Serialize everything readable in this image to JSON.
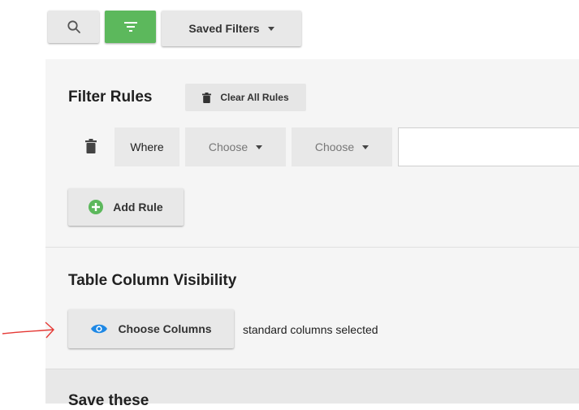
{
  "toolbar": {
    "search_icon": "search-icon",
    "filter_icon": "filter-icon",
    "saved_filters_label": "Saved Filters",
    "filter_active_color": "#5cb85c"
  },
  "filter_rules": {
    "title": "Filter Rules",
    "clear_all_label": "Clear All Rules",
    "rule": {
      "where_label": "Where",
      "field_select_value": "Choose",
      "operator_select_value": "Choose",
      "value_input": ""
    },
    "add_rule_label": "Add Rule"
  },
  "column_visibility": {
    "title": "Table Column Visibility",
    "choose_columns_label": "Choose Columns",
    "status_text": "standard columns selected"
  },
  "save_section": {
    "title": "Save these"
  },
  "colors": {
    "accent_green": "#5cb85c",
    "eye_blue": "#1e88e5",
    "annotation_red": "#e53935"
  }
}
